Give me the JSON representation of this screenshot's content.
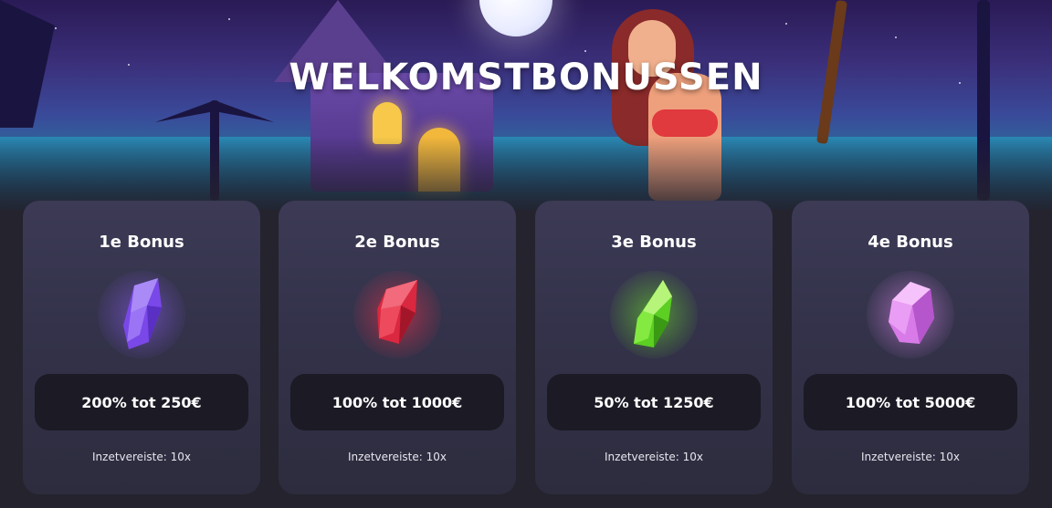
{
  "page": {
    "title": "WELKOMSTBONUSSEN"
  },
  "cards": [
    {
      "title": "1e Bonus",
      "gem_icon": "purple-gem-icon",
      "gem_color": "#8a5cf0",
      "offer": "200% tot 250€",
      "wager": "Inzetvereiste: 10x"
    },
    {
      "title": "2e Bonus",
      "gem_icon": "red-gem-icon",
      "gem_color": "#e8334a",
      "offer": "100% tot 1000€",
      "wager": "Inzetvereiste: 10x"
    },
    {
      "title": "3e Bonus",
      "gem_icon": "green-gem-icon",
      "gem_color": "#6ee02a",
      "offer": "50% tot 1250€",
      "wager": "Inzetvereiste: 10x"
    },
    {
      "title": "4e Bonus",
      "gem_icon": "pink-gem-icon",
      "gem_color": "#e58cf2",
      "offer": "100% tot 5000€",
      "wager": "Inzetvereiste: 10x"
    }
  ],
  "colors": {
    "card_bg": "#33324a",
    "pill_bg": "#1b1a25",
    "page_bg": "#24232e"
  }
}
